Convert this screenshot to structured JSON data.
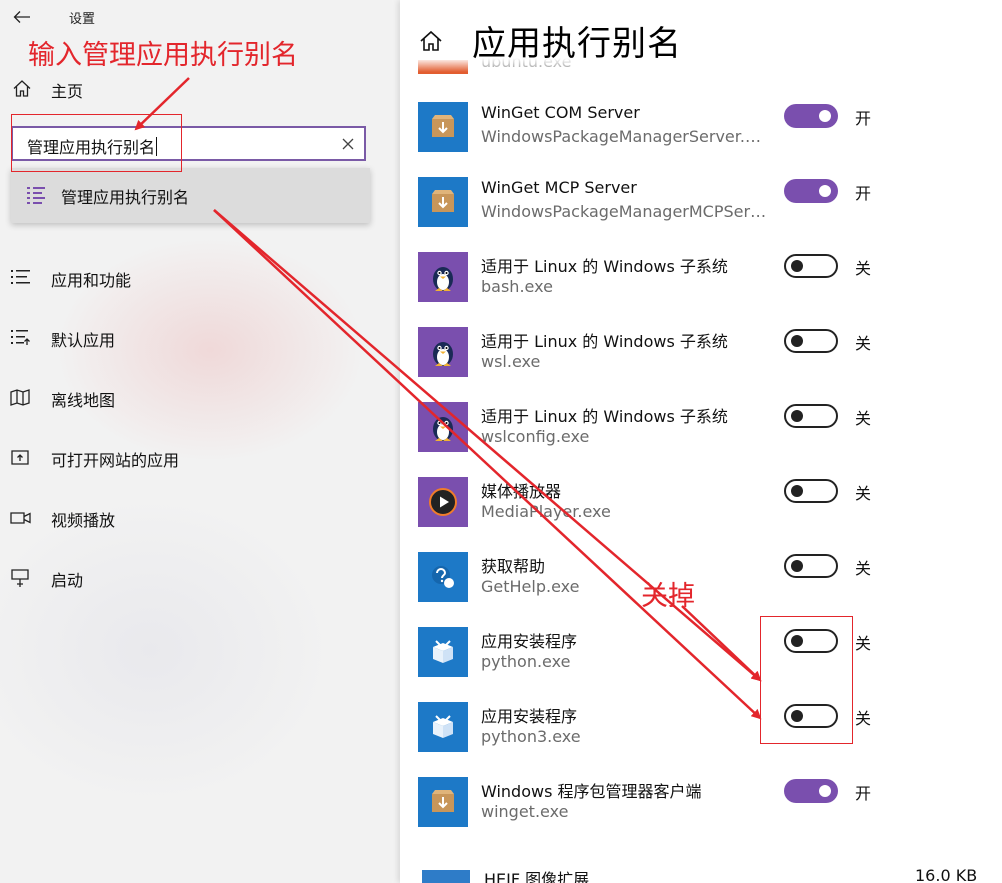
{
  "window": {
    "title": "设置"
  },
  "left_nav": {
    "home_label": "主页",
    "search": {
      "value": "管理应用执行别名"
    },
    "suggestion": {
      "label": "管理应用执行别名",
      "icon": "list-icon"
    },
    "items": [
      {
        "label": "应用和功能",
        "icon": "apps-features-icon"
      },
      {
        "label": "默认应用",
        "icon": "default-apps-icon"
      },
      {
        "label": "离线地图",
        "icon": "offline-maps-icon"
      },
      {
        "label": "可打开网站的应用",
        "icon": "open-websites-icon"
      },
      {
        "label": "视频播放",
        "icon": "video-playback-icon"
      },
      {
        "label": "启动",
        "icon": "startup-icon"
      }
    ]
  },
  "page": {
    "title": "应用执行别名",
    "partial_top_exe": "ubuntu.exe",
    "aliases": [
      {
        "name": "WinGet COM Server",
        "exe": "WindowsPackageManagerServer.exe",
        "on": true,
        "state": "开",
        "icon": "package-icon"
      },
      {
        "name": "WinGet MCP Server",
        "exe": "WindowsPackageManagerMCPServer.exe",
        "on": true,
        "state": "开",
        "icon": "package-icon"
      },
      {
        "name": "适用于 Linux 的 Windows 子系统",
        "exe": "bash.exe",
        "on": false,
        "state": "关",
        "icon": "penguin-icon"
      },
      {
        "name": "适用于 Linux 的 Windows 子系统",
        "exe": "wsl.exe",
        "on": false,
        "state": "关",
        "icon": "penguin-icon"
      },
      {
        "name": "适用于 Linux 的 Windows 子系统",
        "exe": "wslconfig.exe",
        "on": false,
        "state": "关",
        "icon": "penguin-icon"
      },
      {
        "name": "媒体播放器",
        "exe": "MediaPlayer.exe",
        "on": false,
        "state": "关",
        "icon": "media-player-icon"
      },
      {
        "name": "获取帮助",
        "exe": "GetHelp.exe",
        "on": false,
        "state": "关",
        "icon": "get-help-icon"
      },
      {
        "name": "应用安装程序",
        "exe": "python.exe",
        "on": false,
        "state": "关",
        "icon": "app-installer-icon"
      },
      {
        "name": "应用安装程序",
        "exe": "python3.exe",
        "on": false,
        "state": "关",
        "icon": "app-installer-icon"
      },
      {
        "name": "Windows 程序包管理器客户端",
        "exe": "winget.exe",
        "on": true,
        "state": "开",
        "icon": "package-icon"
      }
    ],
    "partial_bottom": {
      "name": "HEIF 图像扩展",
      "size": "16.0 KB"
    }
  },
  "annotations": {
    "search_hint": "输入管理应用执行别名",
    "turn_off_hint": "关掉",
    "color": "#e3262c"
  },
  "colors": {
    "accent": "#7a4fae",
    "annotation": "#e3262c"
  }
}
